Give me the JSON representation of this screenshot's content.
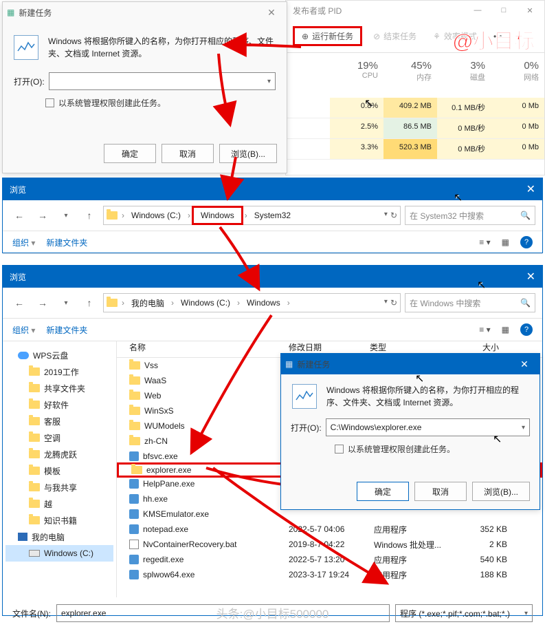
{
  "watermark": "@小目标",
  "footer_watermark": "头条:@小目标500000",
  "task_manager": {
    "title_right": "发布者或 PID",
    "window_min": "—",
    "window_max": "□",
    "window_close": "✕",
    "run_new": "运行新任务",
    "end_task": "结束任务",
    "eff_mode": "效率模式",
    "cols": [
      {
        "pct": "19%",
        "lbl": "CPU"
      },
      {
        "pct": "45%",
        "lbl": "内存"
      },
      {
        "pct": "3%",
        "lbl": "磁盘"
      },
      {
        "pct": "0%",
        "lbl": "网络"
      }
    ],
    "rows": [
      [
        "0.8%",
        "409.2 MB",
        "0.1 MB/秒",
        "0 Mb"
      ],
      [
        "2.5%",
        "86.5 MB",
        "0 MB/秒",
        "0 Mb"
      ],
      [
        "3.3%",
        "520.3 MB",
        "0 MB/秒",
        "0 Mb"
      ]
    ]
  },
  "run1": {
    "title": "新建任务",
    "desc": "Windows 将根据你所键入的名称，为你打开相应的程序、文件夹、文档或 Internet 资源。",
    "open_label": "打开(O):",
    "admin": "以系统管理权限创建此任务。",
    "ok": "确定",
    "cancel": "取消",
    "browse": "浏览(B)..."
  },
  "browse1": {
    "title": "浏览",
    "back": "←",
    "fwd": "→",
    "up": "↑",
    "crumbs": [
      "Windows (C:)",
      "Windows",
      "System32"
    ],
    "refresh": "↻",
    "search_ph": "在 System32 中搜索",
    "organize": "组织",
    "newfolder": "新建文件夹"
  },
  "browse2": {
    "title": "浏览",
    "crumbs": [
      "我的电脑",
      "Windows (C:)",
      "Windows"
    ],
    "search_ph": "在 Windows 中搜索",
    "organize": "组织",
    "newfolder": "新建文件夹",
    "side": [
      {
        "lbl": "WPS云盘",
        "ico": "cloud",
        "lv": 1
      },
      {
        "lbl": "2019工作",
        "ico": "fld",
        "lv": 2
      },
      {
        "lbl": "共享文件夹",
        "ico": "fld",
        "lv": 2
      },
      {
        "lbl": "好软件",
        "ico": "fld",
        "lv": 2
      },
      {
        "lbl": "客服",
        "ico": "fld",
        "lv": 2
      },
      {
        "lbl": "空调",
        "ico": "fld",
        "lv": 2
      },
      {
        "lbl": "龙腾虎跃",
        "ico": "fld",
        "lv": 2
      },
      {
        "lbl": "模板",
        "ico": "fld",
        "lv": 2
      },
      {
        "lbl": "与我共享",
        "ico": "fld",
        "lv": 2
      },
      {
        "lbl": "越",
        "ico": "fld",
        "lv": 2
      },
      {
        "lbl": "知识书籍",
        "ico": "fld",
        "lv": 2
      },
      {
        "lbl": "我的电脑",
        "ico": "pc",
        "lv": 1
      },
      {
        "lbl": "Windows (C:)",
        "ico": "drive",
        "lv": 2,
        "sel": true
      }
    ],
    "hdr": [
      "名称",
      "修改日期",
      "类型",
      "大小"
    ],
    "files": [
      {
        "n": "Vss",
        "ico": "fld"
      },
      {
        "n": "WaaS",
        "ico": "fld"
      },
      {
        "n": "Web",
        "ico": "fld"
      },
      {
        "n": "WinSxS",
        "ico": "fld"
      },
      {
        "n": "WUModels",
        "ico": "fld"
      },
      {
        "n": "zh-CN",
        "ico": "fld"
      },
      {
        "n": "bfsvc.exe",
        "ico": "exe"
      },
      {
        "n": "explorer.exe",
        "ico": "fld",
        "sel": true
      },
      {
        "n": "HelpPane.exe",
        "ico": "exe"
      },
      {
        "n": "hh.exe",
        "ico": "exe"
      },
      {
        "n": "KMSEmulator.exe",
        "ico": "exe"
      },
      {
        "n": "notepad.exe",
        "ico": "exe",
        "d": "2022-5-7 04:06",
        "t": "应用程序",
        "s": "352 KB"
      },
      {
        "n": "NvContainerRecovery.bat",
        "ico": "bat",
        "d": "2019-8-7 04:22",
        "t": "Windows 批处理...",
        "s": "2 KB"
      },
      {
        "n": "regedit.exe",
        "ico": "exe",
        "d": "2022-5-7 13:20",
        "t": "应用程序",
        "s": "540 KB"
      },
      {
        "n": "splwow64.exe",
        "ico": "exe",
        "d": "2023-3-17 19:24",
        "t": "应用程序",
        "s": "188 KB"
      }
    ],
    "fn_label": "文件名(N):",
    "fn_value": "explorer.exe",
    "ft_value": "程序 (*.exe;*.pif;*.com;*.bat;*.)"
  },
  "run2": {
    "title": "新建任务",
    "desc": "Windows 将根据你所键入的名称，为你打开相应的程序、文件夹、文档或 Internet 资源。",
    "open_label": "打开(O):",
    "open_value": "C:\\Windows\\explorer.exe",
    "admin": "以系统管理权限创建此任务。",
    "ok": "确定",
    "cancel": "取消",
    "browse": "浏览(B)..."
  }
}
